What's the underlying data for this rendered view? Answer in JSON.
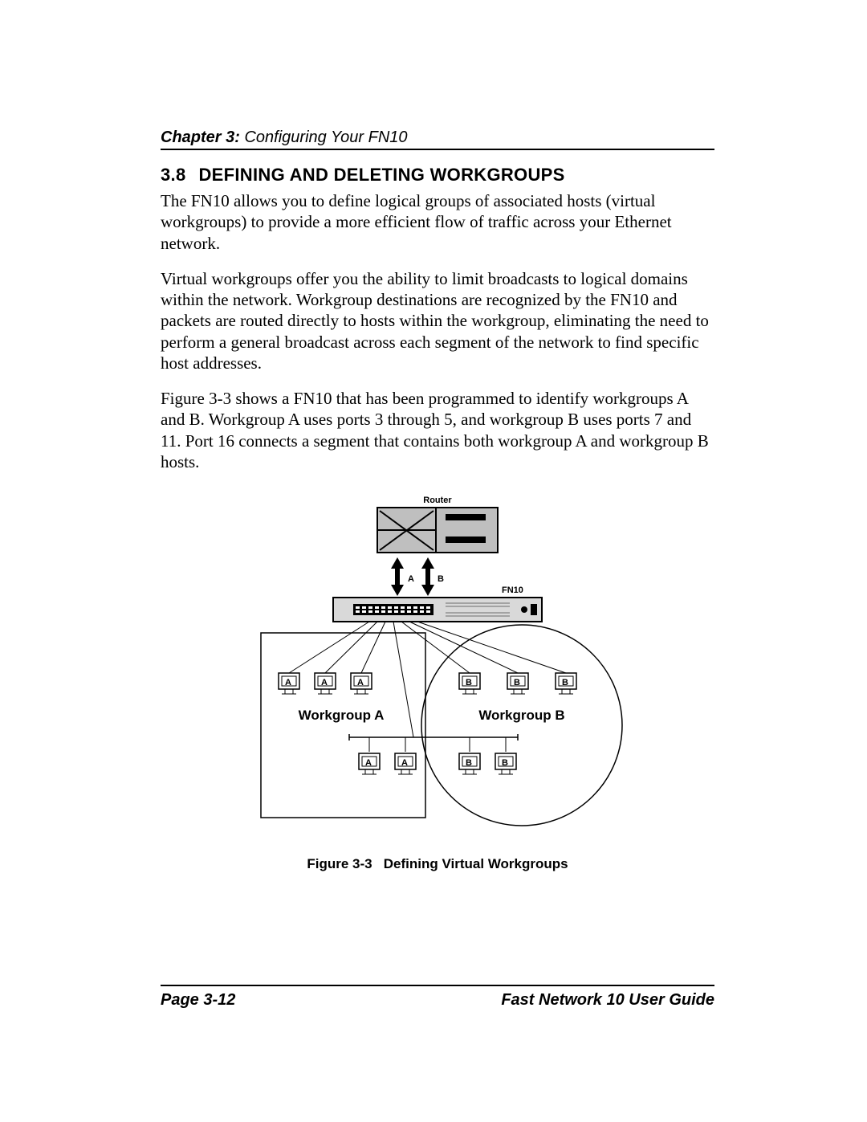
{
  "header": {
    "chapter_prefix": "Chapter 3:",
    "chapter_title": "Configuring Your FN10"
  },
  "section": {
    "number": "3.8",
    "title": "DEFINING AND DELETING WORKGROUPS"
  },
  "paragraphs": {
    "p1": "The FN10 allows you to define logical groups of associated hosts (virtual workgroups) to provide a more efficient flow of traffic across your Ethernet network.",
    "p2": "Virtual workgroups offer you the ability to limit broadcasts to logical domains within the network. Workgroup destinations are recognized by the FN10 and packets are routed directly to hosts within the workgroup, eliminating the need to perform a general broadcast across each segment of the network to find specific host addresses.",
    "p3": "Figure 3-3 shows a FN10 that has been programmed to identify workgroups A and B. Workgroup A uses ports 3 through 5, and workgroup B uses ports 7 and 11. Port 16 connects a segment that contains both workgroup A and workgroup B hosts."
  },
  "diagram": {
    "router_label": "Router",
    "device_label": "FN10",
    "arrow_left_label": "A",
    "arrow_right_label": "B",
    "workgroup_a_label": "Workgroup A",
    "workgroup_b_label": "Workgroup B",
    "host_labels": {
      "a": "A",
      "b": "B"
    }
  },
  "figure_caption": {
    "prefix": "Figure 3-3",
    "text": "Defining Virtual Workgroups"
  },
  "footer": {
    "page": "Page 3-12",
    "guide": "Fast Network 10 User Guide"
  }
}
